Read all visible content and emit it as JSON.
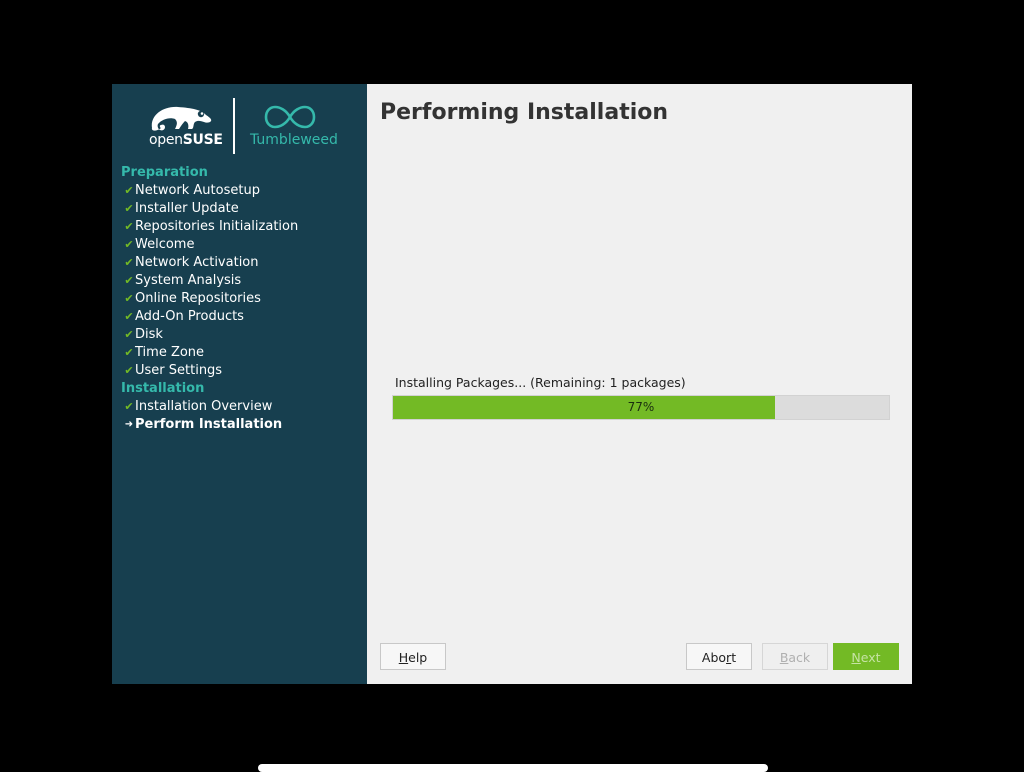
{
  "logo": {
    "brand_prefix": "open",
    "brand_suffix": "SUSE",
    "product": "Tumbleweed",
    "icons": [
      "opensuse-chameleon-icon",
      "tumbleweed-infinity-icon"
    ]
  },
  "sidebar": {
    "sections": [
      {
        "title": "Preparation",
        "steps": [
          {
            "label": "Network Autosetup",
            "state": "done"
          },
          {
            "label": "Installer Update",
            "state": "done"
          },
          {
            "label": "Repositories Initialization",
            "state": "done"
          },
          {
            "label": "Welcome",
            "state": "done"
          },
          {
            "label": "Network Activation",
            "state": "done"
          },
          {
            "label": "System Analysis",
            "state": "done"
          },
          {
            "label": "Online Repositories",
            "state": "done"
          },
          {
            "label": "Add-On Products",
            "state": "done"
          },
          {
            "label": "Disk",
            "state": "done"
          },
          {
            "label": "Time Zone",
            "state": "done"
          },
          {
            "label": "User Settings",
            "state": "done"
          }
        ]
      },
      {
        "title": "Installation",
        "steps": [
          {
            "label": "Installation Overview",
            "state": "done"
          },
          {
            "label": "Perform Installation",
            "state": "current"
          }
        ]
      }
    ]
  },
  "main": {
    "title": "Performing Installation",
    "progress": {
      "label": "Installing Packages... (Remaining: 1 packages)",
      "percent": 77,
      "text": "77%"
    }
  },
  "buttons": {
    "help": {
      "label": "Help",
      "mnemonic_index": 0
    },
    "abort": {
      "label": "Abort",
      "mnemonic_index": 3
    },
    "back": {
      "label": "Back",
      "mnemonic_index": 0,
      "enabled": false
    },
    "next": {
      "label": "Next",
      "mnemonic_index": 0,
      "enabled": false
    }
  },
  "colors": {
    "sidebar_bg": "#173f4f",
    "accent_teal": "#35b9ab",
    "accent_green": "#73ba25",
    "main_bg": "#f0f0f0"
  }
}
